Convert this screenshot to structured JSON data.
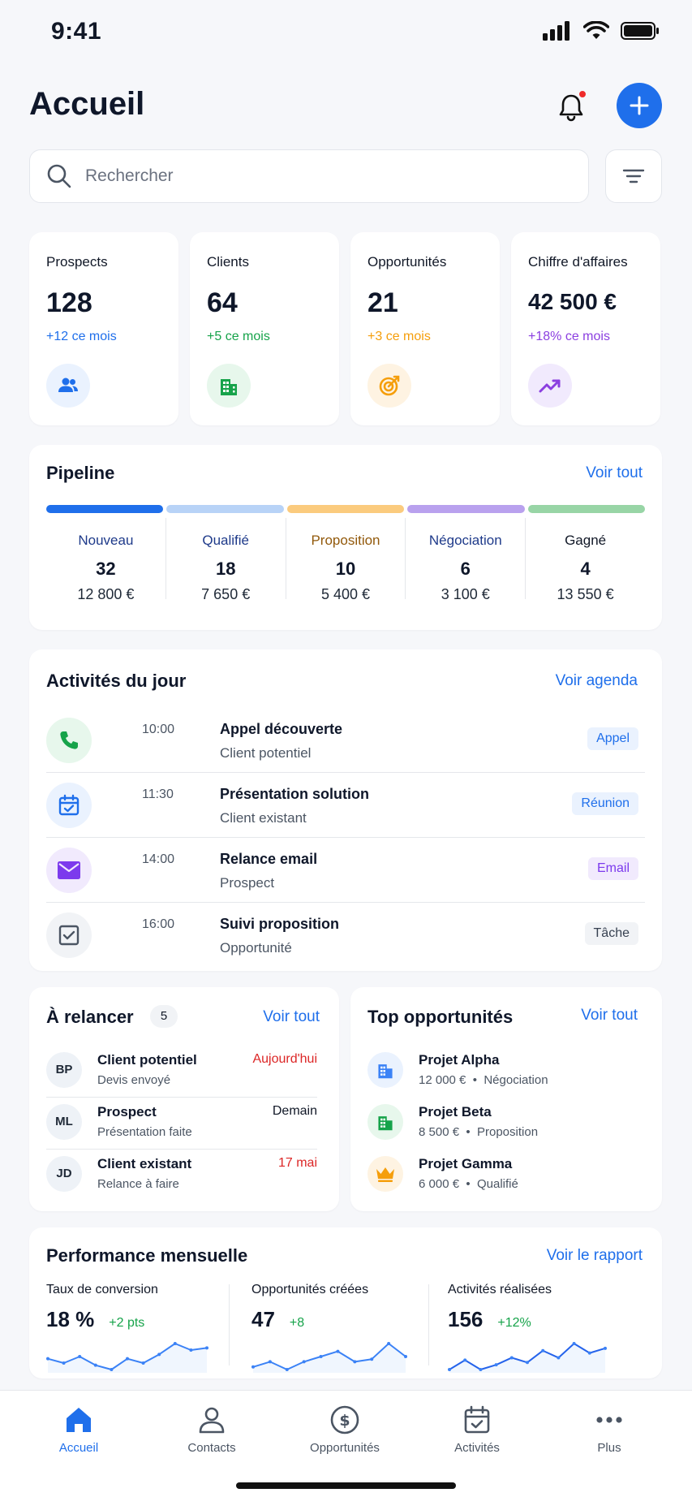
{
  "status_bar": {
    "time": "9:41"
  },
  "header": {
    "title": "Accueil"
  },
  "search": {
    "placeholder": "Rechercher"
  },
  "kpis": [
    {
      "label": "Prospects",
      "value": "128",
      "delta": "+12 ce mois",
      "color": "#1F6FEB",
      "bg": "#EAF2FE",
      "icon": "users-icon"
    },
    {
      "label": "Clients",
      "value": "64",
      "delta": "+5 ce mois",
      "color": "#16A34A",
      "bg": "#E7F7EC",
      "icon": "building-icon"
    },
    {
      "label": "Opportunités",
      "value": "21",
      "delta": "+3 ce mois",
      "color": "#F59E0B",
      "bg": "#FEF3E2",
      "icon": "target-icon"
    },
    {
      "label": "Chiffre d'affaires",
      "value": "42 500 €",
      "delta": "+18% ce mois",
      "color": "#8B3FE0",
      "bg": "#F1EAFD",
      "icon": "trend-up-icon"
    }
  ],
  "pipeline": {
    "title": "Pipeline",
    "link": "Voir tout",
    "stages": [
      {
        "name": "Nouveau",
        "count": "32",
        "amount": "12 800 €",
        "color": "#1F6FEB",
        "text_color": "#1E3A8A"
      },
      {
        "name": "Qualifié",
        "count": "18",
        "amount": "7 650 €",
        "color": "#B8D3F7",
        "text_color": "#1E3A8A"
      },
      {
        "name": "Proposition",
        "count": "10",
        "amount": "5 400 €",
        "color": "#FBCB7E",
        "text_color": "#92590B"
      },
      {
        "name": "Négociation",
        "count": "6",
        "amount": "3 100 €",
        "color": "#B9A1EE",
        "text_color": "#1E3A8A"
      },
      {
        "name": "Gagné",
        "count": "4",
        "amount": "13 550 €",
        "color": "#98D5A6",
        "text_color": "#111827"
      }
    ]
  },
  "activities": {
    "title": "Activités du jour",
    "link": "Voir agenda",
    "items": [
      {
        "time": "10:00",
        "title": "Appel découverte",
        "subtitle": "Client potentiel",
        "badge": "Appel",
        "icon": "phone-icon",
        "icon_color": "#16A34A",
        "icon_bg": "#E7F7EC",
        "badge_color": "#1F6FEB",
        "badge_bg": "#EAF2FE"
      },
      {
        "time": "11:30",
        "title": "Présentation solution",
        "subtitle": "Client existant",
        "badge": "Réunion",
        "icon": "calendar-check-icon",
        "icon_color": "#1F6FEB",
        "icon_bg": "#EAF2FE",
        "badge_color": "#1F6FEB",
        "badge_bg": "#EAF2FE"
      },
      {
        "time": "14:00",
        "title": "Relance email",
        "subtitle": "Prospect",
        "badge": "Email",
        "icon": "mail-icon",
        "icon_color": "#7C3AED",
        "icon_bg": "#F1EAFD",
        "badge_color": "#7C3AED",
        "badge_bg": "#F1EAFD"
      },
      {
        "time": "16:00",
        "title": "Suivi proposition",
        "subtitle": "Opportunité",
        "badge": "Tâche",
        "icon": "checkbox-icon",
        "icon_color": "#4B5563",
        "icon_bg": "#F1F3F6",
        "badge_color": "#374151",
        "badge_bg": "#F1F3F6"
      }
    ]
  },
  "follow_up": {
    "title": "À relancer",
    "count": "5",
    "link": "Voir tout",
    "items": [
      {
        "initials": "BP",
        "name": "Client potentiel",
        "subtitle": "Devis envoyé",
        "date": "Aujourd'hui",
        "date_color": "#DC2626"
      },
      {
        "initials": "ML",
        "name": "Prospect",
        "subtitle": "Présentation faite",
        "date": "Demain",
        "date_color": "#111827"
      },
      {
        "initials": "JD",
        "name": "Client existant",
        "subtitle": "Relance à faire",
        "date": "17 mai",
        "date_color": "#DC2626"
      }
    ]
  },
  "top_opportunities": {
    "title": "Top opportunités",
    "link": "Voir tout",
    "items": [
      {
        "name": "Projet Alpha",
        "amount": "12 000 €",
        "separator": "•",
        "stage": "Négociation",
        "icon": "building-icon",
        "icon_color": "#3B82F6",
        "icon_bg": "#EAF2FE"
      },
      {
        "name": "Projet Beta",
        "amount": "8 500 €",
        "separator": "•",
        "stage": "Proposition",
        "icon": "building-icon",
        "icon_color": "#16A34A",
        "icon_bg": "#E7F7EC"
      },
      {
        "name": "Projet Gamma",
        "amount": "6 000 €",
        "separator": "•",
        "stage": "Qualifié",
        "icon": "crown-icon",
        "icon_color": "#F59E0B",
        "icon_bg": "#FEF3E2"
      }
    ]
  },
  "performance": {
    "title": "Performance mensuelle",
    "link": "Voir le rapport",
    "metrics": [
      {
        "label": "Taux de conversion",
        "value": "18 %",
        "delta": "+2 pts",
        "trend": [
          12,
          10,
          13,
          9,
          7,
          12,
          10,
          14,
          19,
          16,
          17
        ]
      },
      {
        "label": "Opportunités créées",
        "value": "47",
        "delta": "+8",
        "trend": [
          10,
          12,
          9,
          12,
          14,
          16,
          12,
          13,
          19,
          14
        ]
      },
      {
        "label": "Activités réalisées",
        "value": "156",
        "delta": "+12%",
        "trend": [
          9,
          13,
          9,
          11,
          14,
          12,
          17,
          14,
          20,
          16,
          18
        ]
      }
    ]
  },
  "tabbar": {
    "tabs": [
      {
        "label": "Accueil",
        "icon": "home-icon",
        "active": true
      },
      {
        "label": "Contacts",
        "icon": "user-icon",
        "active": false
      },
      {
        "label": "Opportunités",
        "icon": "dollar-icon",
        "active": false
      },
      {
        "label": "Activités",
        "icon": "calendar-check-icon",
        "active": false
      },
      {
        "label": "Plus",
        "icon": "more-icon",
        "active": false
      }
    ]
  },
  "colors": {
    "accent": "#1F6FEB",
    "background": "#F6F7FA",
    "alert": "#EF2B2B"
  }
}
